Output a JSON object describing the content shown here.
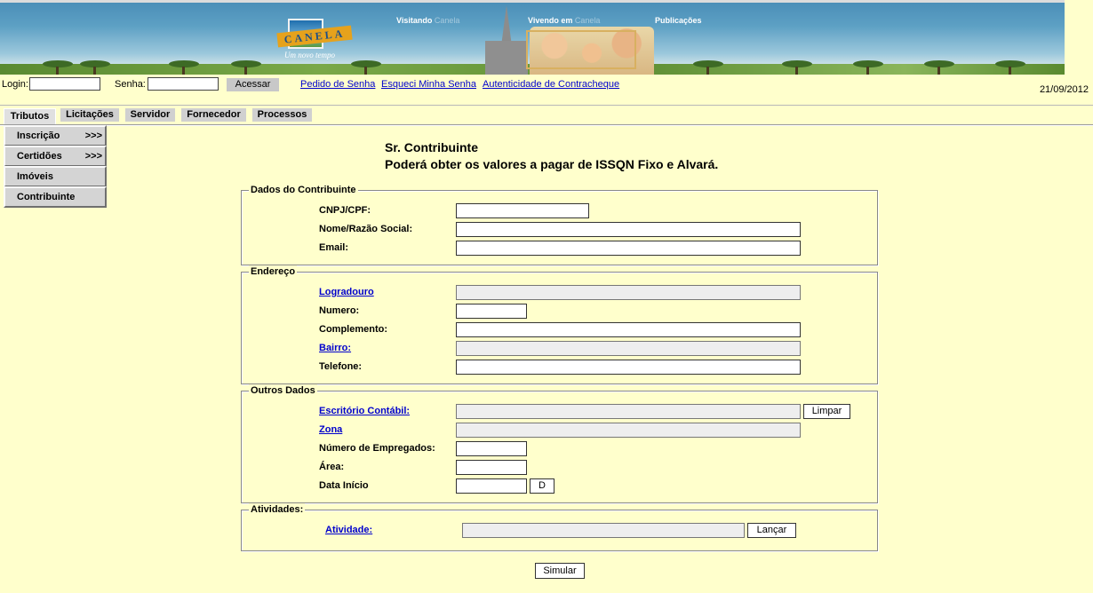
{
  "banner": {
    "logo_word": "CANELA",
    "logo_tagline": "Um novo tempo",
    "nav": [
      {
        "bold": "Visitando",
        "faded": "Canela"
      },
      {
        "bold": "Vivendo em",
        "faded": "Canela"
      },
      {
        "bold": "Publicações",
        "faded": ""
      }
    ]
  },
  "login": {
    "login_label": "Login:",
    "login_value": "",
    "senha_label": "Senha:",
    "senha_value": "",
    "acessar_label": "Acessar",
    "links": [
      "Pedido de Senha",
      "Esqueci Minha Senha",
      "Autenticidade de Contracheque"
    ],
    "date": "21/09/2012"
  },
  "tabs": [
    "Tributos",
    "Licitações",
    "Servidor",
    "Fornecedor",
    "Processos"
  ],
  "active_tab": "Tributos",
  "side_menu": [
    {
      "label": "Inscrição",
      "arrow": ">>>"
    },
    {
      "label": "Certidões",
      "arrow": ">>>"
    },
    {
      "label": "Imóveis",
      "arrow": ""
    },
    {
      "label": "Contribuinte",
      "arrow": ""
    }
  ],
  "heading": {
    "line1": "Sr. Contribuinte",
    "line2": "Poderá obter os valores a pagar de ISSQN Fixo e Alvará."
  },
  "dados": {
    "legend": "Dados do Contribuinte",
    "cnpj_label": "CNPJ/CPF:",
    "cnpj_value": "",
    "nome_label": "Nome/Razão Social:",
    "nome_value": "",
    "email_label": "Email:",
    "email_value": ""
  },
  "endereco": {
    "legend": "Endereço",
    "logradouro_label": "Logradouro",
    "logradouro_value": "",
    "numero_label": "Numero:",
    "numero_value": "",
    "complemento_label": "Complemento:",
    "complemento_value": "",
    "bairro_label": "Bairro:",
    "bairro_value": "",
    "telefone_label": "Telefone:",
    "telefone_value": ""
  },
  "outros": {
    "legend": "Outros Dados",
    "escritorio_label": "Escritório Contábil:",
    "escritorio_value": "",
    "limpar_label": "Limpar",
    "zona_label": "Zona",
    "zona_value": "",
    "empregados_label": "Número de Empregados:",
    "empregados_value": "",
    "area_label": "Área:",
    "area_value": "",
    "data_label": "Data Início",
    "data_value": "",
    "d_label": "D"
  },
  "atividades": {
    "legend": "Atividades:",
    "atividade_label": "Atividade:",
    "atividade_value": "",
    "lancar_label": "Lançar"
  },
  "simular_label": "Simular",
  "colors": {
    "page_bg": "#ffffcc",
    "link": "#0000cc",
    "button_gray": "#c8c8c8",
    "readonly_field": "#eeeeee"
  }
}
